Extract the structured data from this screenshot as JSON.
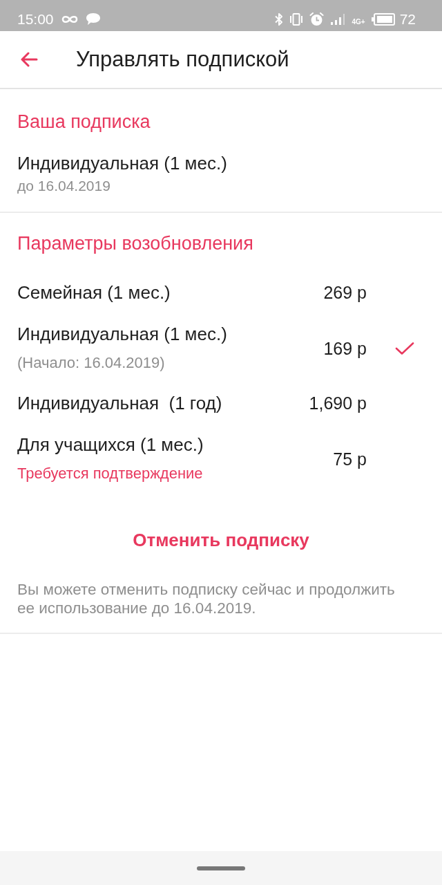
{
  "status_bar": {
    "time": "15:00",
    "network": "4G+",
    "battery": "72"
  },
  "app_bar": {
    "title": "Управлять подпиской"
  },
  "current_subscription": {
    "heading": "Ваша подписка",
    "plan": "Индивидуальная (1 мес.)",
    "expires": "до 16.04.2019"
  },
  "renewal_options": {
    "heading": "Параметры возобновления",
    "plans": [
      {
        "name": "Семейная (1 мес.)",
        "price": "269 р",
        "selected": false
      },
      {
        "name": "Индивидуальная (1 мес.)",
        "note": {
          "text": "(Начало: 16.04.2019)",
          "kind": "info"
        },
        "price": "169 р",
        "selected": true
      },
      {
        "name": "Индивидуальная  (1 год)",
        "price": "1,690 р",
        "selected": false
      },
      {
        "name": "Для учащихся (1 мес.)",
        "note": {
          "text": "Требуется подтверждение",
          "kind": "warning"
        },
        "price": "75 р",
        "selected": false
      }
    ]
  },
  "cancel_button": {
    "label": "Отменить подписку"
  },
  "footnote": "Вы можете отменить подписку сейчас и продолжить ее использование до 16.04.2019."
}
